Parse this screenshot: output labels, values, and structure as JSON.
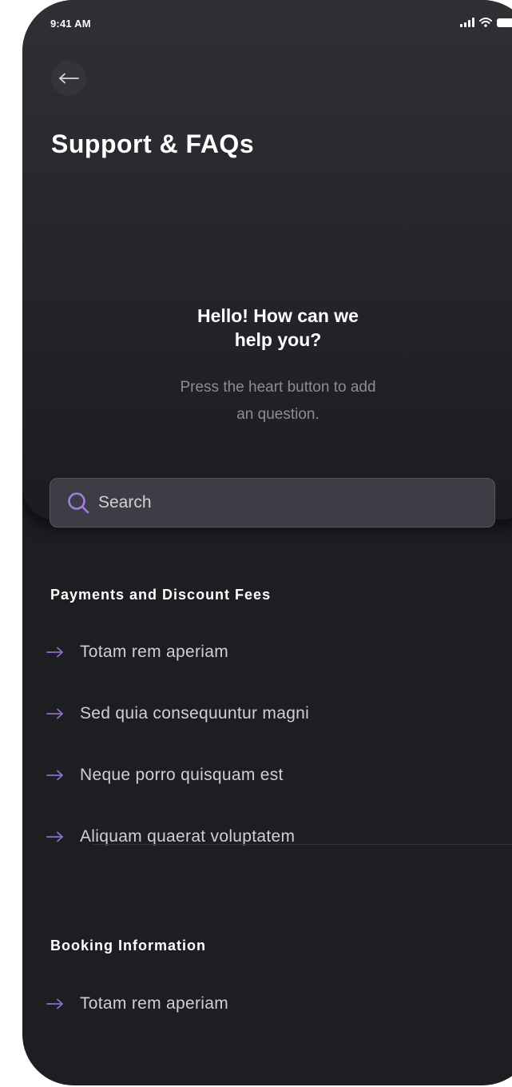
{
  "status_bar": {
    "time": "9:41 AM",
    "icons": [
      "signal-icon",
      "wifi-icon",
      "battery-icon"
    ]
  },
  "header": {
    "back_icon": "arrow-left-icon",
    "title": "Support & FAQs"
  },
  "hero": {
    "heading_line1": "Hello! How can we",
    "heading_line2": "help you?",
    "hint_line1": "Press the heart button to add",
    "hint_line2": "an question."
  },
  "search": {
    "placeholder": "Search",
    "icon": "search-icon"
  },
  "sections": [
    {
      "title": "Payments and Discount Fees",
      "items": [
        "Totam rem aperiam",
        "Sed quia consequuntur magni",
        "Neque porro quisquam est",
        "Aliquam quaerat voluptatem"
      ]
    },
    {
      "title": "Booking Information",
      "items": [
        "Totam rem aperiam"
      ]
    }
  ],
  "colors": {
    "background": "#1d1e22",
    "hero": "#2a2b30",
    "accent": "#9b7bd4",
    "search_field": "#3c3d45"
  }
}
